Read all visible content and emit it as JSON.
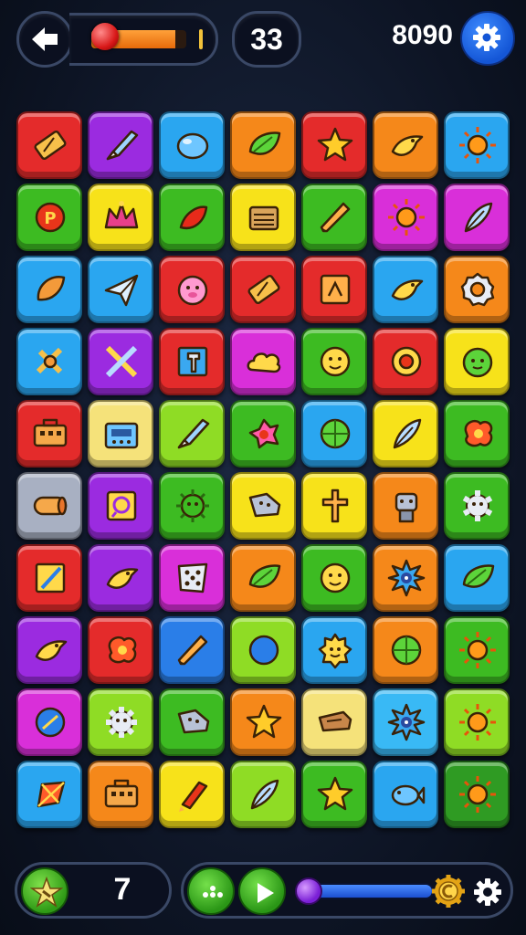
{
  "hud": {
    "moves": "33",
    "score": "8090",
    "health_percent": 0.88,
    "bonus_count": "7",
    "progress_percent": 1.0
  },
  "icons": {
    "back": "back-arrow-icon",
    "settings_top": "gear-icon",
    "bonus": "star-burst-icon",
    "hint": "dots-icon",
    "play": "play-icon",
    "coin": "coin-icon",
    "settings_bottom": "gear-icon"
  },
  "colors": {
    "red": "#e42b2b",
    "purple": "#9b2be0",
    "blue": "#2aa6f0",
    "orange": "#f5881a",
    "green": "#3dbb22",
    "yellow": "#f7e21a",
    "magenta": "#d92fd9",
    "lime": "#8fdc25",
    "gray": "#a8b0c2",
    "skyblue": "#39b9f5",
    "cream": "#f5e27a",
    "royal": "#2a7ee8",
    "darkgreen": "#2f9b23"
  },
  "board": [
    [
      [
        "red",
        "battery-icon"
      ],
      [
        "purple",
        "brush-icon"
      ],
      [
        "blue",
        "bubble-icon"
      ],
      [
        "orange",
        "leaf-icon"
      ],
      [
        "red",
        "star-icon"
      ],
      [
        "orange",
        "bird-icon"
      ],
      [
        "blue",
        "sun-icon"
      ]
    ],
    [
      [
        "green",
        "coin-p-icon"
      ],
      [
        "yellow",
        "crown-icon"
      ],
      [
        "green",
        "chili-icon"
      ],
      [
        "yellow",
        "chest-icon"
      ],
      [
        "green",
        "pencil-icon"
      ],
      [
        "magenta",
        "sun-icon"
      ],
      [
        "magenta",
        "feather-icon"
      ]
    ],
    [
      [
        "blue",
        "shell-icon"
      ],
      [
        "blue",
        "paper-plane-icon"
      ],
      [
        "red",
        "pig-icon"
      ],
      [
        "red",
        "battery-icon"
      ],
      [
        "red",
        "sign-icon"
      ],
      [
        "blue",
        "bird-icon"
      ],
      [
        "orange",
        "ring-icon"
      ]
    ],
    [
      [
        "blue",
        "swords-icon"
      ],
      [
        "purple",
        "cross-swords-icon"
      ],
      [
        "red",
        "hammer-icon"
      ],
      [
        "magenta",
        "cloud-icon"
      ],
      [
        "green",
        "smile-face-icon"
      ],
      [
        "red",
        "eye-icon"
      ],
      [
        "yellow",
        "slime-face-icon"
      ]
    ],
    [
      [
        "red",
        "toolbox-icon"
      ],
      [
        "cream",
        "radio-icon"
      ],
      [
        "lime",
        "brush-icon"
      ],
      [
        "green",
        "flower-icon"
      ],
      [
        "blue",
        "ball-icon"
      ],
      [
        "yellow",
        "feather-icon"
      ],
      [
        "green",
        "splat-icon"
      ]
    ],
    [
      [
        "gray",
        "scroll-icon"
      ],
      [
        "purple",
        "frame-icon"
      ],
      [
        "green",
        "virus-icon"
      ],
      [
        "yellow",
        "boot-icon"
      ],
      [
        "yellow",
        "cross-icon"
      ],
      [
        "orange",
        "robot-icon"
      ],
      [
        "green",
        "gear-icon"
      ]
    ],
    [
      [
        "red",
        "pen-note-icon"
      ],
      [
        "purple",
        "bird-icon"
      ],
      [
        "magenta",
        "dice-icon"
      ],
      [
        "orange",
        "leaf-icon"
      ],
      [
        "green",
        "smile-face-icon"
      ],
      [
        "orange",
        "spiky-eye-icon"
      ],
      [
        "blue",
        "leaf-icon"
      ]
    ],
    [
      [
        "purple",
        "bird-icon"
      ],
      [
        "red",
        "splat-icon"
      ],
      [
        "royal",
        "pencil-icon"
      ],
      [
        "lime",
        "compass-icon"
      ],
      [
        "blue",
        "happy-face-icon"
      ],
      [
        "orange",
        "ball-icon"
      ],
      [
        "green",
        "sun-icon"
      ]
    ],
    [
      [
        "magenta",
        "plate-icon"
      ],
      [
        "lime",
        "gear-face-icon"
      ],
      [
        "green",
        "boot-icon"
      ],
      [
        "orange",
        "star-icon"
      ],
      [
        "cream",
        "bone-icon"
      ],
      [
        "skyblue",
        "spiky-eye-icon"
      ],
      [
        "lime",
        "sun-icon"
      ]
    ],
    [
      [
        "blue",
        "kite-icon"
      ],
      [
        "orange",
        "toolbox-icon"
      ],
      [
        "yellow",
        "rocket-icon"
      ],
      [
        "lime",
        "feather-icon"
      ],
      [
        "green",
        "star-icon"
      ],
      [
        "blue",
        "fish-icon"
      ],
      [
        "darkgreen",
        "sun-icon"
      ]
    ]
  ]
}
